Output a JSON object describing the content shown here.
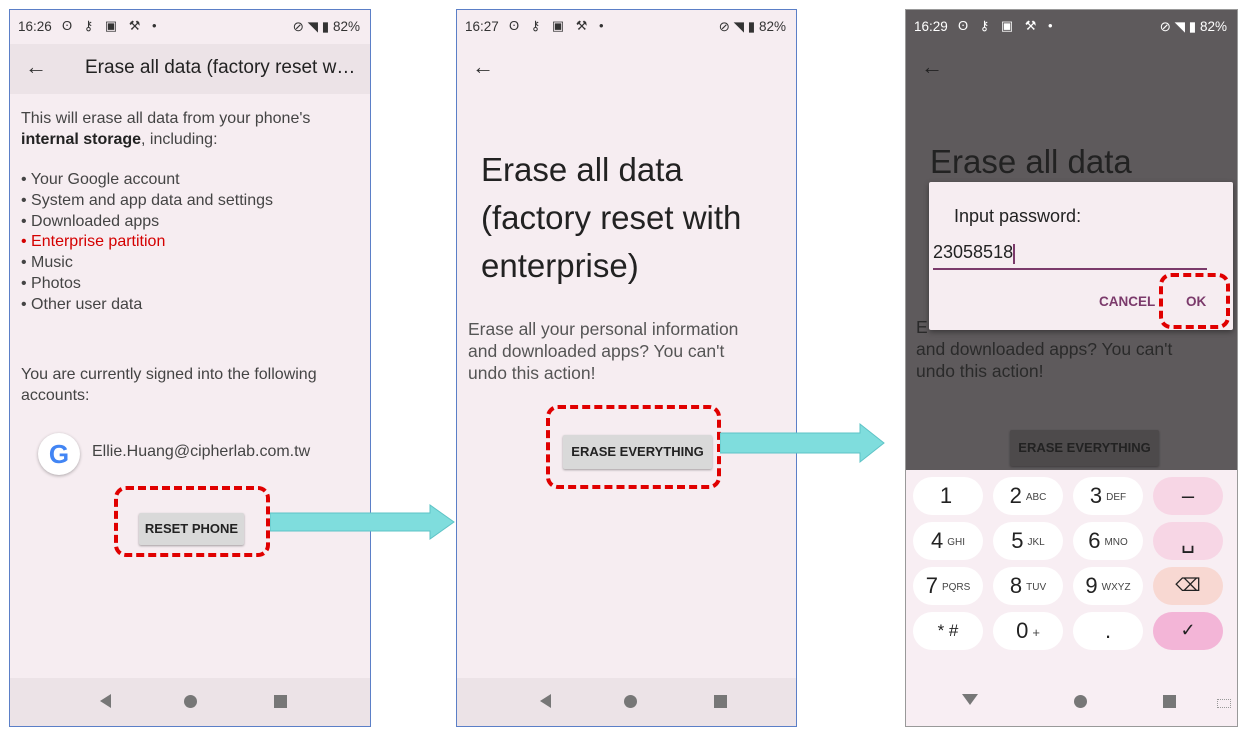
{
  "screen1": {
    "status": {
      "time": "16:26",
      "icons": "ʘ ⚷ ▣ ⚒ •",
      "right": "⊘ ◥ ▮ 82%"
    },
    "title": "Erase all data (factory reset w…",
    "intro_a": "This will erase all data from your phone's",
    "intro_b_bold": "internal storage",
    "intro_b_rest": ", including:",
    "items": [
      "• Your Google account",
      "• System and app data and settings",
      "• Downloaded apps",
      "• Enterprise partition",
      "• Music",
      "• Photos",
      "• Other user data"
    ],
    "highlight_color": "#d40000",
    "accounts_text_1": "You are currently signed into the following",
    "accounts_text_2": "accounts:",
    "account_logo": "G",
    "account_email": "Ellie.Huang@cipherlab.com.tw",
    "reset_button": "RESET PHONE"
  },
  "screen2": {
    "status": {
      "time": "16:27",
      "icons": "ʘ ⚷ ▣ ⚒ •",
      "right": "⊘ ◥ ▮ 82%"
    },
    "heading_lines": [
      "Erase all data",
      "(factory reset with",
      "enterprise)"
    ],
    "body_lines": [
      "Erase all your personal information",
      "and downloaded apps? You can't",
      "undo this action!"
    ],
    "erase_button": "ERASE EVERYTHING"
  },
  "screen3": {
    "status": {
      "time": "16:29",
      "icons": "ʘ ⚷ ▣ ⚒ •",
      "right": "⊘ ◥ ▮ 82%"
    },
    "heading": "Erase all data",
    "body_line1_partial": "E",
    "body_lines": [
      "and downloaded apps? You can't",
      "undo this action!"
    ],
    "erase_button": "ERASE EVERYTHING",
    "dialog": {
      "title": "Input password:",
      "password_value": "23058518",
      "cancel_label": "CANCEL",
      "ok_label": "OK",
      "accent": "#7b3a6b"
    },
    "keypad": [
      {
        "num": "1",
        "sub": ""
      },
      {
        "num": "2",
        "sub": "ABC"
      },
      {
        "num": "3",
        "sub": "DEF"
      },
      {
        "num": "–",
        "sub": ""
      },
      {
        "num": "4",
        "sub": "GHI"
      },
      {
        "num": "5",
        "sub": "JKL"
      },
      {
        "num": "6",
        "sub": "MNO"
      },
      {
        "num": "␣",
        "sub": ""
      },
      {
        "num": "7",
        "sub": "PQRS"
      },
      {
        "num": "8",
        "sub": "TUV"
      },
      {
        "num": "9",
        "sub": "WXYZ"
      },
      {
        "num": "⌫",
        "sub": ""
      },
      {
        "num": "* #",
        "sub": ""
      },
      {
        "num": "0",
        "sub": "+"
      },
      {
        "num": ".",
        "sub": ""
      },
      {
        "num": "✓",
        "sub": ""
      }
    ]
  }
}
